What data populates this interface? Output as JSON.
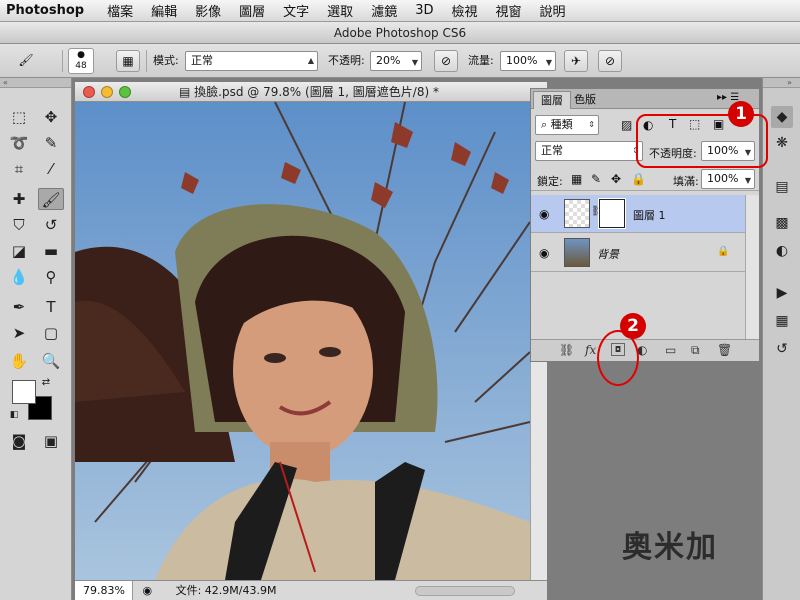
{
  "menubar": {
    "app": "Photoshop",
    "items": [
      "檔案",
      "編輯",
      "影像",
      "圖層",
      "文字",
      "選取",
      "濾鏡",
      "3D",
      "檢視",
      "視窗",
      "說明"
    ]
  },
  "window": {
    "title": "Adobe Photoshop CS6"
  },
  "options": {
    "brush_size": "48",
    "mode_label": "模式:",
    "mode_value": "正常",
    "opacity_label": "不透明:",
    "opacity_value": "20%",
    "flow_label": "流量:",
    "flow_value": "100%"
  },
  "document": {
    "title": "換臉.psd @ 79.8% (圖層 1, 圖層遮色片/8) *",
    "zoom": "79.83%",
    "file_info": "文件: 42.9M/43.9M"
  },
  "layers_panel": {
    "tabs": [
      "圖層",
      "色版"
    ],
    "filter_label": "種類",
    "blend_mode": "正常",
    "opacity_label": "不透明度:",
    "opacity_value": "100%",
    "lock_label": "鎖定:",
    "fill_label": "填滿:",
    "fill_value": "100%",
    "layers": [
      {
        "name": "圖層 1",
        "selected": true,
        "has_mask": true
      },
      {
        "name": "背景",
        "selected": false,
        "locked": true
      }
    ],
    "footer_icons": [
      "link-icon",
      "fx-icon",
      "add-mask-icon",
      "adjustment-icon",
      "folder-icon",
      "new-layer-icon",
      "trash-icon"
    ]
  },
  "annotations": {
    "badge1": "1",
    "badge2": "2"
  },
  "watermark": "奧米加",
  "colors": {
    "annotation_red": "#e00000",
    "selection_blue": "#b8c9ef"
  }
}
